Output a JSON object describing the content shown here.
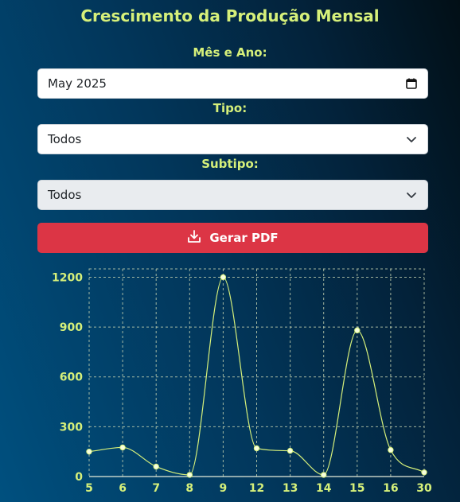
{
  "page_title": "Crescimento da Produção Mensal",
  "filters": {
    "month_label": "Mês e Ano:",
    "month_value": "May 2025",
    "tipo_label": "Tipo:",
    "tipo_value": "Todos",
    "subtipo_label": "Subtipo:",
    "subtipo_value": "Todos"
  },
  "actions": {
    "pdf_button": "Gerar PDF"
  },
  "icons": {
    "calendar": "calendar-icon",
    "chevron": "chevron-down-icon",
    "download": "download-icon"
  },
  "colors": {
    "title": "#d6f07a",
    "button": "#dc3545",
    "line": "#d6f07a"
  },
  "chart_data": {
    "type": "line",
    "categories": [
      "5",
      "6",
      "7",
      "8",
      "9",
      "12",
      "13",
      "14",
      "15",
      "16",
      "30"
    ],
    "values": [
      150,
      175,
      60,
      10,
      1200,
      170,
      155,
      10,
      880,
      160,
      25
    ],
    "ylim": [
      0,
      1250
    ],
    "yticks": [
      0,
      300,
      600,
      900,
      1200
    ],
    "grid": true
  }
}
